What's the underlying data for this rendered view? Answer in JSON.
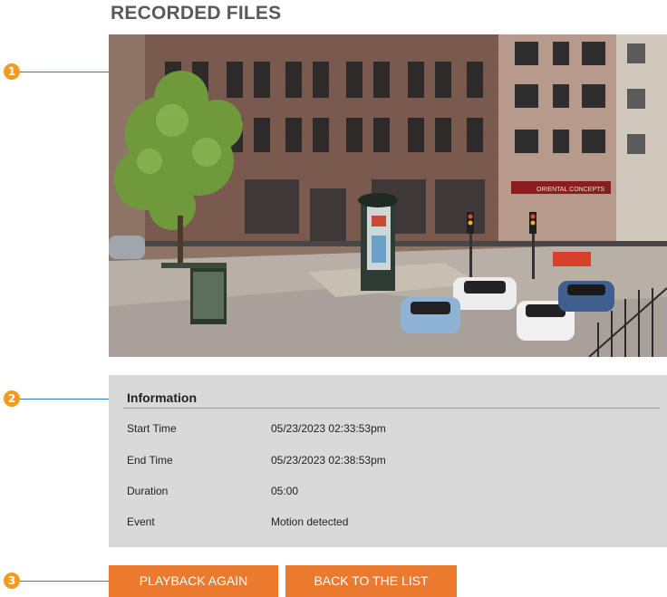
{
  "page": {
    "title": "RECORDED FILES"
  },
  "callouts": [
    {
      "number": "1"
    },
    {
      "number": "2"
    },
    {
      "number": "3"
    }
  ],
  "info": {
    "heading": "Information",
    "rows": [
      {
        "label": "Start Time",
        "value": "05/23/2023 02:33:53pm"
      },
      {
        "label": "End Time",
        "value": "05/23/2023 02:38:53pm"
      },
      {
        "label": "Duration",
        "value": "05:00"
      },
      {
        "label": "Event",
        "value": "Motion detected"
      }
    ]
  },
  "buttons": {
    "playback_again": "PLAYBACK AGAIN",
    "back_to_list": "BACK TO THE LIST"
  },
  "video": {
    "sign_text": "ORIENTAL CONCEPTS"
  },
  "colors": {
    "accent_orange": "#ec7a2e",
    "callout_orange": "#f39a1f",
    "callout_line_blue": "#2f7fbf",
    "panel_gray": "#d9d9d9",
    "title_gray": "#595959"
  }
}
